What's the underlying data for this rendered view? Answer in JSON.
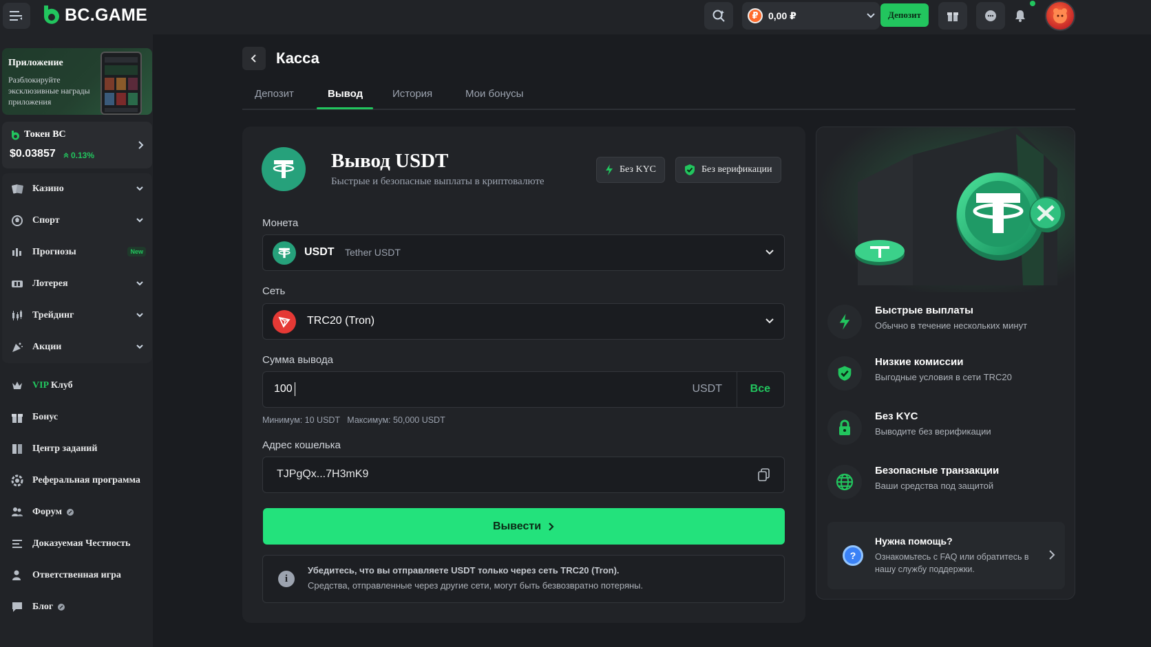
{
  "header": {
    "brand": "BC.GAME",
    "balance": "0,00 ₽",
    "currency_symbol": "₽",
    "deposit_label": "Депозит"
  },
  "sidebar": {
    "promo": {
      "title": "Приложение",
      "subtitle": "Разблокируйте эксклюзивные награды приложения"
    },
    "token": {
      "title": "Токен BC",
      "price": "$0.03857",
      "change": "0.13%"
    },
    "group1": [
      {
        "label": "Казино",
        "icon": "casino-icon"
      },
      {
        "label": "Спорт",
        "icon": "sport-icon"
      },
      {
        "label": "Прогнозы",
        "icon": "predictions-icon",
        "badge": "New"
      },
      {
        "label": "Лотерея",
        "icon": "lottery-icon"
      },
      {
        "label": "Трейдинг",
        "icon": "trading-icon"
      },
      {
        "label": "Акции",
        "icon": "promotions-icon"
      }
    ],
    "group2": [
      {
        "label_prefix": "VIP",
        "label": "Клуб",
        "icon": "vip-icon"
      },
      {
        "label": "Бонус",
        "icon": "gift-icon"
      },
      {
        "label": "Центр заданий",
        "icon": "tasks-icon"
      },
      {
        "label": "Реферальная программа",
        "icon": "referral-icon"
      },
      {
        "label": "Форум",
        "icon": "forum-icon"
      },
      {
        "label": "Доказуемая Честность",
        "icon": "fairness-icon"
      },
      {
        "label": "Ответственная игра",
        "icon": "responsible-icon"
      },
      {
        "label": "Блог",
        "icon": "blog-icon"
      }
    ]
  },
  "page": {
    "title": "Касса",
    "tabs": [
      "Депозит",
      "Вывод",
      "История",
      "Мои бонусы"
    ],
    "active_tab": "Вывод"
  },
  "withdraw": {
    "title": "Вывод USDT",
    "subtitle": "Быстрые и безопасные выплаты в криптовалюте",
    "badge_kyc": "Без KYC",
    "badge_verify": "Без верификации",
    "coin_label": "Монета",
    "coin_symbol": "USDT",
    "coin_name": "Tether USDT",
    "network_label": "Сеть",
    "network_value": "TRC20 (Tron)",
    "amount_label": "Сумма вывода",
    "amount_value": "100",
    "amount_unit": "USDT",
    "all_label": "Все",
    "limits": "Минимум: 10 USDT   Максимум: 50,000 USDT",
    "address_label": "Адрес кошелька",
    "address_value": "TJPgQx...7H3mK9",
    "submit_label": "Вывести",
    "notice_line1": "Убедитесь, что вы отправляете USDT только через сеть TRC20 (Tron).",
    "notice_line2": "Средства, отправленные через другие сети, могут быть безвозвратно потеряны."
  },
  "features": [
    {
      "title": "Быстрые выплаты",
      "subtitle": "Обычно в течение нескольких минут",
      "icon": "lightning-icon"
    },
    {
      "title": "Низкие комиссии",
      "subtitle": "Выгодные условия в сети TRC20",
      "icon": "shield-check-icon"
    },
    {
      "title": "Без KYC",
      "subtitle": "Выводите без верификации",
      "icon": "lock-icon"
    },
    {
      "title": "Безопасные транзакции",
      "subtitle": "Ваши средства под защитой",
      "icon": "globe-icon"
    }
  ],
  "help": {
    "title": "Нужна помощь?",
    "subtitle": "Ознакомьтесь с FAQ или обратитесь в нашу службу поддержки."
  },
  "colors": {
    "accent": "#22c55e",
    "button": "#23e27c",
    "tether": "#26a17b",
    "tron": "#e53935",
    "background": "#1a1c20",
    "panel": "#212327"
  }
}
